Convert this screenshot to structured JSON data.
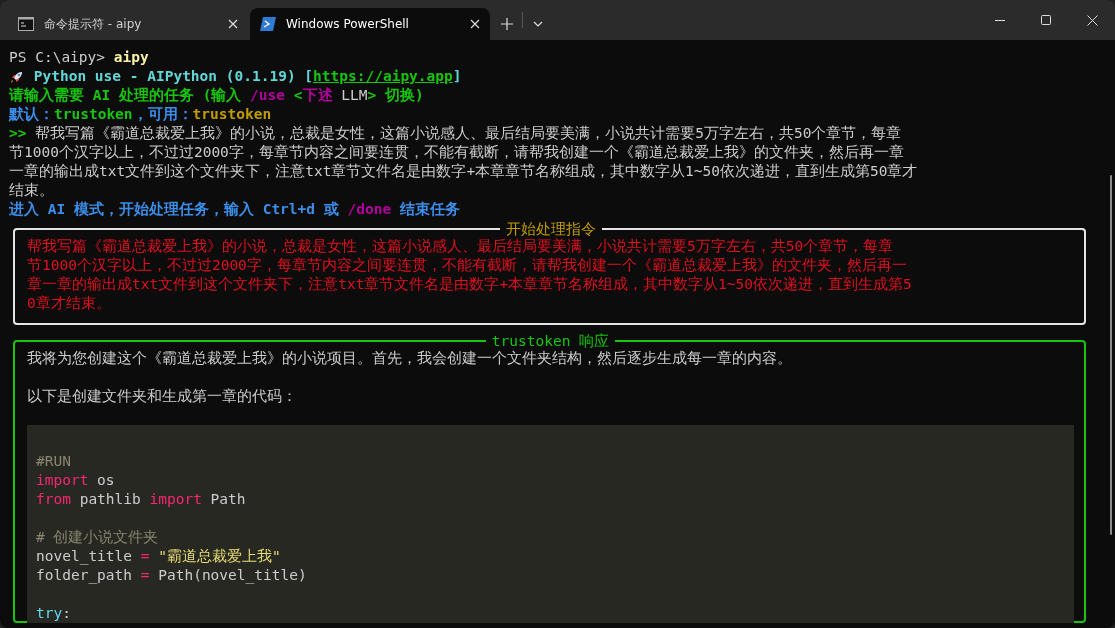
{
  "tabs": [
    {
      "label": "命令提示符 - aipy",
      "selected": false
    },
    {
      "label": "Windows PowerShell",
      "selected": true
    }
  ],
  "terminal": {
    "lines": [
      [
        {
          "text": "PS C:\\aipy> ",
          "kind": "plain"
        },
        {
          "text": "aipy",
          "kind": "command"
        }
      ],
      [
        {
          "kind": "rocket"
        },
        {
          "text": " Python use - AIPython (0.1.19) [",
          "kind": "cyan"
        },
        {
          "text": "https://aipy.app",
          "kind": "link"
        },
        {
          "text": "]",
          "kind": "cyan"
        }
      ],
      [
        {
          "text": "请输入需要 AI 处理的任务 (输入 ",
          "kind": "green"
        },
        {
          "text": "/use",
          "kind": "magenta"
        },
        {
          "text": " <",
          "kind": "green"
        },
        {
          "text": "下述",
          "kind": "magenta"
        },
        {
          "text": " LLM",
          "kind": "plain"
        },
        {
          "text": "> 切换)",
          "kind": "green"
        }
      ],
      [
        {
          "text": "默认：",
          "kind": "blue"
        },
        {
          "text": "trustoken",
          "kind": "green"
        },
        {
          "text": "，可用：",
          "kind": "blue"
        },
        {
          "text": "trustoken",
          "kind": "gold"
        }
      ],
      [
        {
          "text": ">> ",
          "kind": "green"
        },
        {
          "text": "帮我写篇《霸道总裁爱上我》的小说，总裁是女性，这篇小说感人、最后结局要美满，小说共计需要5万字左右，共50个章节，每章",
          "kind": "plain"
        }
      ],
      [
        {
          "text": "节1000个汉字以上，不过过2000字，每章节内容之间要连贯，不能有截断，请帮我创建一个《霸道总裁爱上我》的文件夹，然后再一章",
          "kind": "plain"
        }
      ],
      [
        {
          "text": "一章的输出成txt文件到这个文件夹下，注意txt章节文件名是由数字+本章章节名称组成，其中数字从1~50依次递进，直到生成第50章才",
          "kind": "plain"
        }
      ],
      [
        {
          "text": "结束。",
          "kind": "plain"
        }
      ],
      [
        {
          "text": "进入 AI 模式，开始处理任务，输入 Ctrl+d 或 ",
          "kind": "blue"
        },
        {
          "text": "/done",
          "kind": "magenta"
        },
        {
          "text": " 结束任务",
          "kind": "blue"
        }
      ]
    ],
    "instruction_panel": {
      "title": "开始处理指令",
      "lines": [
        "帮我写篇《霸道总裁爱上我》的小说，总裁是女性，这篇小说感人、最后结局要美满，小说共计需要5万字左右，共50个章节，每章",
        "节1000个汉字以上，不过过2000字，每章节内容之间要连贯，不能有截断，请帮我创建一个《霸道总裁爱上我》的文件夹，然后再一",
        "章一章的输出成txt文件到这个文件夹下，注意txt章节文件名是由数字+本章章节名称组成，其中数字从1~50依次递进，直到生成第5",
        "0章才结束。"
      ]
    },
    "response_panel": {
      "title": "trustoken 响应",
      "paragraphs": [
        "我将为您创建这个《霸道总裁爱上我》的小说项目。首先，我会创建一个文件夹结构，然后逐步生成每一章的内容。",
        "以下是创建文件夹和生成第一章的代码："
      ],
      "code": [
        {
          "kind": "blank"
        },
        {
          "kind": "code",
          "segments": [
            {
              "text": "#RUN",
              "kind": "comment"
            }
          ]
        },
        {
          "kind": "code",
          "segments": [
            {
              "text": "import",
              "kind": "keyword"
            },
            {
              "text": " os",
              "kind": "plain"
            }
          ]
        },
        {
          "kind": "code",
          "segments": [
            {
              "text": "from",
              "kind": "keyword"
            },
            {
              "text": " pathlib ",
              "kind": "plain"
            },
            {
              "text": "import",
              "kind": "keyword"
            },
            {
              "text": " Path",
              "kind": "plain"
            }
          ]
        },
        {
          "kind": "blank"
        },
        {
          "kind": "code",
          "segments": [
            {
              "text": "# 创建小说文件夹",
              "kind": "comment"
            }
          ]
        },
        {
          "kind": "code",
          "segments": [
            {
              "text": "novel_title ",
              "kind": "plain"
            },
            {
              "text": "=",
              "kind": "keyword"
            },
            {
              "text": " \"霸道总裁爱上我\"",
              "kind": "string"
            }
          ]
        },
        {
          "kind": "code",
          "segments": [
            {
              "text": "folder_path ",
              "kind": "plain"
            },
            {
              "text": "=",
              "kind": "keyword"
            },
            {
              "text": " Path(novel_title)",
              "kind": "plain"
            }
          ]
        },
        {
          "kind": "blank"
        },
        {
          "kind": "code",
          "segments": [
            {
              "text": "try",
              "kind": "builtin"
            },
            {
              "text": ":",
              "kind": "plain"
            }
          ]
        }
      ]
    }
  }
}
